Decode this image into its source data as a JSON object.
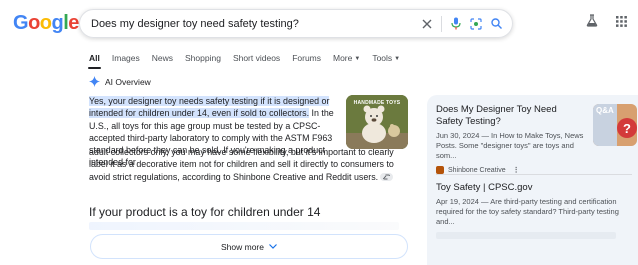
{
  "logo": {
    "text": "Google"
  },
  "search": {
    "query": "Does my designer toy need safety testing?",
    "icons": [
      "close-icon",
      "mic-icon",
      "lens-icon",
      "search-icon"
    ]
  },
  "header_icons": [
    "labs-flask-icon",
    "apps-grid-icon"
  ],
  "tabs": [
    {
      "label": "All",
      "active": true
    },
    {
      "label": "Images"
    },
    {
      "label": "News"
    },
    {
      "label": "Shopping"
    },
    {
      "label": "Short videos"
    },
    {
      "label": "Forums"
    },
    {
      "label": "More"
    },
    {
      "label": "Tools"
    }
  ],
  "ai_overview": {
    "title": "AI Overview",
    "highlight": "Yes, your designer toy needs safety testing if it is designed or intended for children under 14, even if sold to collectors.",
    "body_a": " In the U.S., all toys for this age group must be tested by a CPSC-accepted third-party laboratory to comply with the ASTM F963 standard before they can be sold. If you're making a product intended for",
    "body_b": "adult collectors only, you may have some flexibility, but it's important to clearly label it as a decorative item not for children and sell it directly to consumers to avoid strict regulations, according to ",
    "link1": "Shinbone Creative",
    "and": " and ",
    "link2": "Reddit users",
    "period": ".",
    "thumb_label": "HANDMADE TOYS",
    "subheading": "If your product is a toy for children under 14",
    "show_more": "Show more"
  },
  "side": {
    "card1": {
      "title": "Does My Designer Toy Need Safety Testing?",
      "meta": "Jun 30, 2024 — In How to Make Toys, News Posts. Some \"designer toys\" are toys and som...",
      "source": "Shinbone Creative",
      "image_label": "Q&A"
    },
    "card2": {
      "title": "Toy Safety | CPSC.gov",
      "meta": "Apr 19, 2024 — Are third-party testing and certification required for the toy safety standard? Third-party testing and..."
    }
  },
  "colors": {
    "highlight": "#d3e3fd",
    "link": "#1a0dab",
    "panel": "#f0f4f9"
  }
}
